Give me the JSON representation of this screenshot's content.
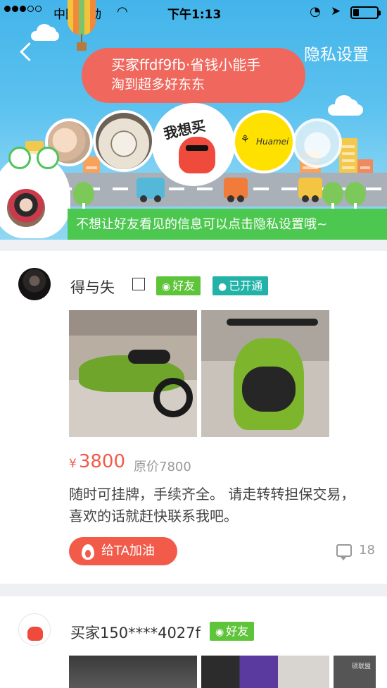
{
  "status_bar": {
    "signal_dots_filled": 3,
    "signal_dots_total": 5,
    "carrier": "中国移动",
    "time": "下午1:13",
    "battery_level": 0.25
  },
  "header": {
    "back_icon": "chevron-left-icon",
    "privacy_label": "隐私设置",
    "bubble_line1": "买家ffdf9fb·省钱小能手",
    "bubble_line2": "淘到超多好东东",
    "avatar3_text": "我想买",
    "avatar4_text": "Huamei",
    "hint": "不想让好友看见的信息可以点击隐私设置哦~",
    "colors": {
      "sky": "#43b4ea",
      "bubble": "#f0685d",
      "strip": "#4cc74f"
    }
  },
  "feed": [
    {
      "seller": "得与失",
      "tags": [
        {
          "icon": "wechat-icon",
          "label": "好友"
        },
        {
          "icon": "droplet-icon",
          "label": "已开通"
        }
      ],
      "price_currency": "¥",
      "price": "3800",
      "original_price": "原价7800",
      "description": "随时可挂牌，手续齐全。 请走转转担保交易，喜欢的话就赶快联系我吧。",
      "cheer_label": "给TA加油",
      "comment_count": "18"
    },
    {
      "seller": "买家150****4027f",
      "tags": [
        {
          "icon": "wechat-icon",
          "label": "好友"
        }
      ],
      "thumb3_text": "硕联盟"
    }
  ],
  "accent_colors": {
    "price": "#f25a4a",
    "tag_friend": "#5ec43a",
    "tag_open": "#22b2a8"
  }
}
